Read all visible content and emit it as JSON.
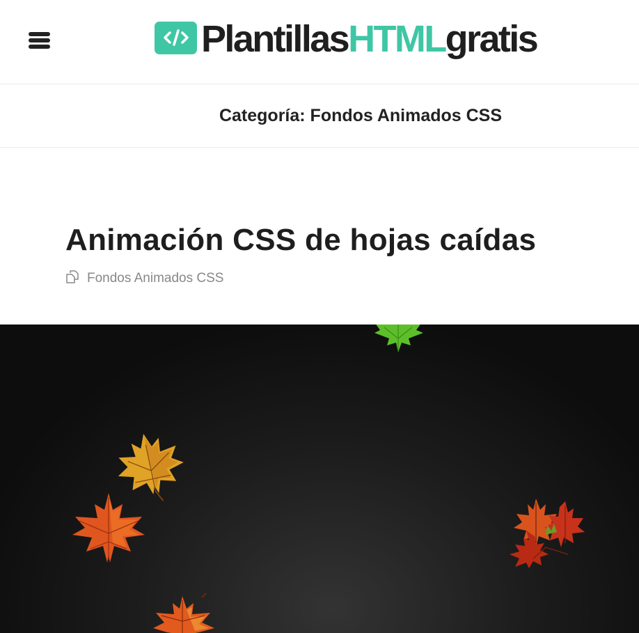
{
  "header": {
    "menu_icon": "hamburger-menu-icon",
    "logo": {
      "badge_icon": "code-icon",
      "text_part1": "Plantillas",
      "text_part2": "HTML",
      "text_part3": "gratis",
      "color_dark": "#1f1f1f",
      "color_accent": "#3fc6a5"
    }
  },
  "category_bar": {
    "title": "Categoría: Fondos Animados CSS"
  },
  "post": {
    "title": "Animación CSS de hojas caídas",
    "category_icon": "copy-icon",
    "category_link": "Fondos Animados CSS"
  },
  "hero": {
    "background": "#111111",
    "leaves": [
      "green-maple-leaf",
      "yellow-maple-leaf",
      "red-maple-leaf",
      "red-maple-leaves-cluster",
      "orange-maple-leaf"
    ]
  }
}
